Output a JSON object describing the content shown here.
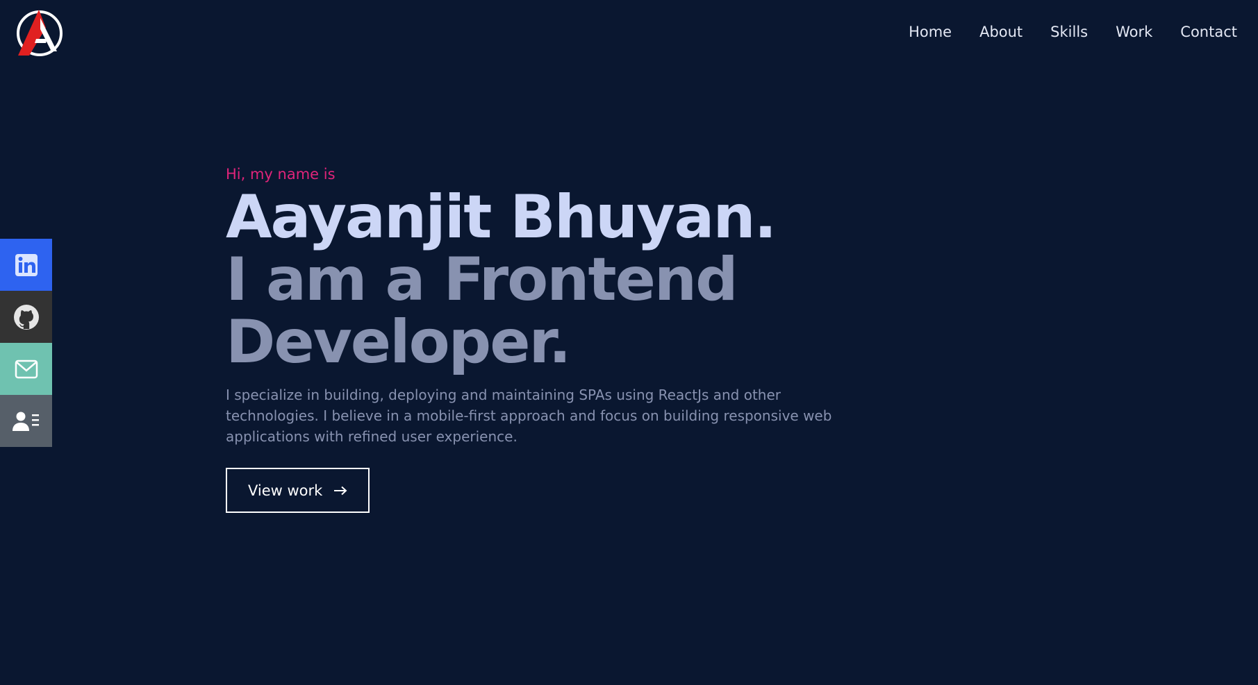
{
  "logo": {
    "icon": "brand-logo-icon",
    "colors": {
      "primary": "#e02020",
      "ring": "#ffffff"
    }
  },
  "nav": {
    "items": [
      {
        "label": "Home"
      },
      {
        "label": "About"
      },
      {
        "label": "Skills"
      },
      {
        "label": "Work"
      },
      {
        "label": "Contact"
      }
    ]
  },
  "social": {
    "items": [
      {
        "icon": "linkedin-icon",
        "color": "#2e63f0"
      },
      {
        "icon": "github-icon",
        "color": "#333333"
      },
      {
        "icon": "mail-icon",
        "color": "#6fc2b0"
      },
      {
        "icon": "resume-icon",
        "color": "#565f69"
      }
    ]
  },
  "hero": {
    "greeting": "Hi, my name is",
    "name": "Aayanjit Bhuyan.",
    "role": "I am a Frontend Developer.",
    "description": "I specialize in building, deploying and maintaining SPAs using ReactJs and other technologies. I believe in a mobile-first approach and focus on building responsive web applications with refined user experience.",
    "cta_label": "View work",
    "cta_icon": "arrow-right-icon"
  },
  "colors": {
    "background": "#0a1730",
    "accent": "#e0247a",
    "heading": "#ccd6f6",
    "muted": "#8892b0"
  }
}
